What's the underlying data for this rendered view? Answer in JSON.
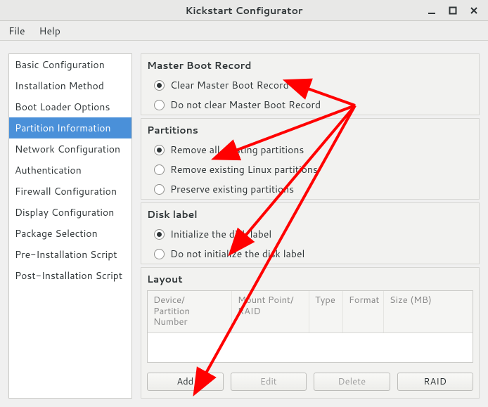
{
  "window": {
    "title": "Kickstart Configurator"
  },
  "menu": {
    "file": "File",
    "help": "Help"
  },
  "sidebar": {
    "items": [
      {
        "label": "Basic Configuration"
      },
      {
        "label": "Installation Method"
      },
      {
        "label": "Boot Loader Options"
      },
      {
        "label": "Partition Information"
      },
      {
        "label": "Network Configuration"
      },
      {
        "label": "Authentication"
      },
      {
        "label": "Firewall Configuration"
      },
      {
        "label": "Display Configuration"
      },
      {
        "label": "Package Selection"
      },
      {
        "label": "Pre-Installation Script"
      },
      {
        "label": "Post-Installation Script"
      }
    ],
    "selected_index": 3
  },
  "mbr": {
    "title": "Master Boot Record",
    "opts": [
      "Clear Master Boot Record",
      "Do not clear Master Boot Record"
    ],
    "selected": 0
  },
  "parts": {
    "title": "Partitions",
    "opts": [
      "Remove all existing partitions",
      "Remove existing Linux partitions",
      "Preserve existing partitions"
    ],
    "selected": 0
  },
  "disklabel": {
    "title": "Disk label",
    "opts": [
      "Initialize the disk label",
      "Do not initialize the disk label"
    ],
    "selected": 0
  },
  "layout": {
    "title": "Layout",
    "columns": {
      "device": "Device/\nPartition Number",
      "mount": "Mount Point/\nRAID",
      "type": "Type",
      "format": "Format",
      "size": "Size (MB)"
    },
    "rows": []
  },
  "buttons": {
    "add": "Add",
    "edit": "Edit",
    "delete": "Delete",
    "raid": "RAID"
  }
}
